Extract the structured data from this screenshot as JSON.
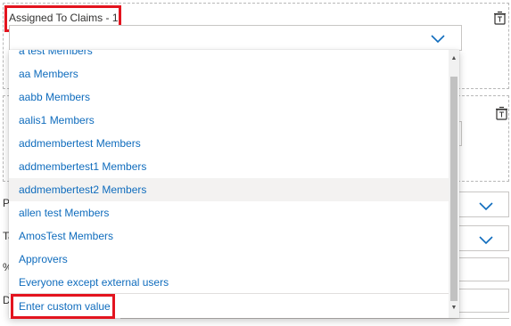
{
  "claims_field": {
    "label": "Assigned To Claims - 1",
    "icon": "chevron-down-icon",
    "delete_icon": "delete-icon"
  },
  "second_field": {
    "delete_icon": "delete-icon"
  },
  "side_labels": [
    "P",
    "Ta",
    "%",
    "D"
  ],
  "dropdown": {
    "options": [
      "a test Members",
      "aa Members",
      "aabb Members",
      "aalis1 Members",
      "addmembertest Members",
      "addmembertest1 Members",
      "addmembertest2 Members",
      "allen test Members",
      "AmosTest Members",
      "Approvers",
      "Everyone except external users"
    ],
    "hovered_option": "addmembertest2 Members",
    "custom_value": "Enter custom value"
  },
  "colors": {
    "link": "#0f6cbd",
    "highlight_box": "#e3141f",
    "chevron": "#0f6cbd"
  }
}
